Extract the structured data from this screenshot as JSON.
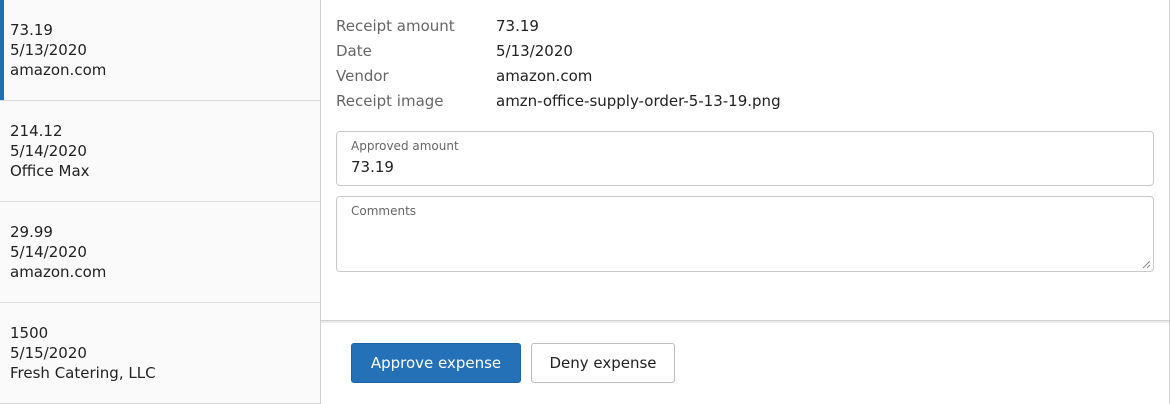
{
  "list": {
    "items": [
      {
        "amount": "73.19",
        "date": "5/13/2020",
        "vendor": "amazon.com",
        "selected": true
      },
      {
        "amount": "214.12",
        "date": "5/14/2020",
        "vendor": "Office Max",
        "selected": false
      },
      {
        "amount": "29.99",
        "date": "5/14/2020",
        "vendor": "amazon.com",
        "selected": false
      },
      {
        "amount": "1500",
        "date": "5/15/2020",
        "vendor": "Fresh Catering, LLC",
        "selected": false
      }
    ]
  },
  "detail": {
    "fields": [
      {
        "label": "Receipt amount",
        "value": "73.19"
      },
      {
        "label": "Date",
        "value": "5/13/2020"
      },
      {
        "label": "Vendor",
        "value": "amazon.com"
      },
      {
        "label": "Receipt image",
        "value": "amzn-office-supply-order-5-13-19.png"
      }
    ],
    "approved_amount": {
      "label": "Approved amount",
      "value": "73.19"
    },
    "comments": {
      "label": "Comments",
      "value": ""
    }
  },
  "actions": {
    "approve_label": "Approve expense",
    "deny_label": "Deny expense"
  },
  "colors": {
    "accent": "#2471b8",
    "selection_bar": "#1f6fb5"
  }
}
